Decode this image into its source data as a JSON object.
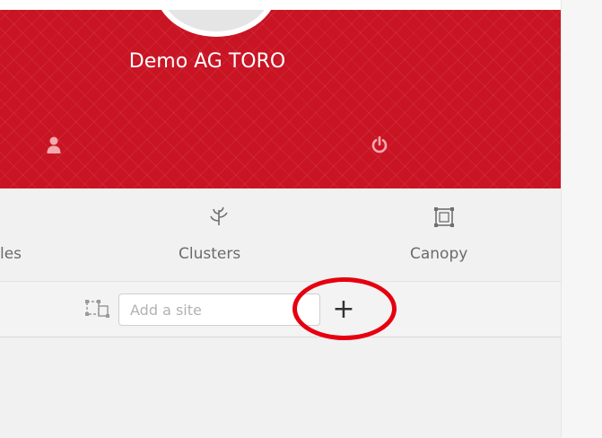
{
  "header": {
    "user_name": "Demo AG TORO",
    "profile_icon": "user-icon",
    "logout_icon": "power-icon",
    "accent_color": "#c91424"
  },
  "nav": {
    "items": [
      {
        "label": "les",
        "icon": "vehicles-icon"
      },
      {
        "label": "Clusters",
        "icon": "plant-icon"
      },
      {
        "label": "Canopy",
        "icon": "canopy-icon"
      }
    ]
  },
  "site_bar": {
    "input_placeholder": "Add a site",
    "input_value": "",
    "add_label": "+",
    "site_icon": "site-frame-icon"
  },
  "annotation": {
    "highlight_color": "#e6000f"
  }
}
